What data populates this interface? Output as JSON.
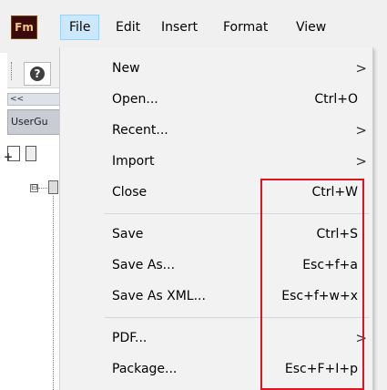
{
  "app": {
    "icon_label": "Fm"
  },
  "menubar": {
    "items": [
      {
        "label": "File"
      },
      {
        "label": "Edit"
      },
      {
        "label": "Insert"
      },
      {
        "label": "Format"
      },
      {
        "label": "View"
      }
    ]
  },
  "panel": {
    "help_icon_glyph": "?",
    "collapse_glyph": "<<",
    "tab_label": "UserGu",
    "tree_expander_glyph": "⊟"
  },
  "file_menu": {
    "items": [
      {
        "label": "New",
        "shortcut": "",
        "submenu_arrow": ">"
      },
      {
        "label": "Open...",
        "shortcut": "Ctrl+O",
        "submenu_arrow": ""
      },
      {
        "label": "Recent...",
        "shortcut": "",
        "submenu_arrow": ">"
      },
      {
        "label": "Import",
        "shortcut": "",
        "submenu_arrow": ">"
      },
      {
        "label": "Close",
        "shortcut": "Ctrl+W",
        "submenu_arrow": ""
      },
      {
        "label": "Save",
        "shortcut": "Ctrl+S",
        "submenu_arrow": ""
      },
      {
        "label": "Save As...",
        "shortcut": "Esc+f+a",
        "submenu_arrow": ""
      },
      {
        "label": "Save As XML...",
        "shortcut": "Esc+f+w+x",
        "submenu_arrow": ""
      },
      {
        "label": "PDF...",
        "shortcut": "",
        "submenu_arrow": ">"
      },
      {
        "label": "Package...",
        "shortcut": "Esc+F+I+p",
        "submenu_arrow": ""
      }
    ]
  },
  "colors": {
    "active_menu_bg": "#cce8ff",
    "highlight_border": "#e0141e",
    "app_icon_bg": "#3b0a0a",
    "app_icon_text": "#f5c67a"
  }
}
